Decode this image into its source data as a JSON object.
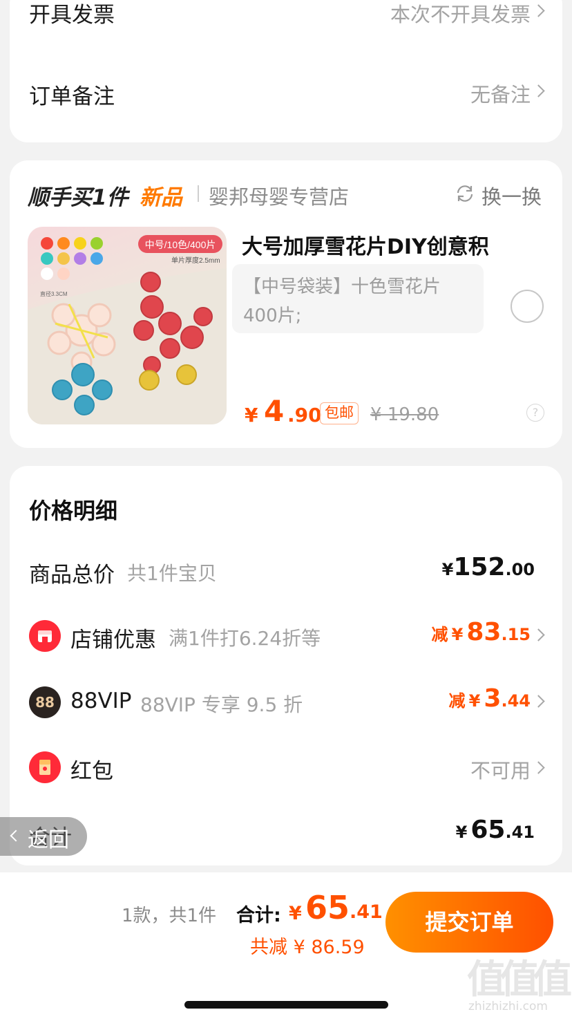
{
  "invoice": {
    "label": "开具发票",
    "value": "本次不开具发票"
  },
  "order_note": {
    "label": "订单备注",
    "value": "无备注"
  },
  "add_on": {
    "title": "顺手买1件",
    "new_tag": "新品",
    "store": "婴邦母婴专营店",
    "swap": "换一换",
    "product": {
      "title": "大号加厚雪花片DIY创意积",
      "sku": "【中号袋装】十色雪花片 400片;",
      "price_symbol": "¥",
      "price_int": "4",
      "price_dec": ".90",
      "free_shipping": "包邮",
      "original_price": "¥ 19.80",
      "image_badge": "中号/10色/400片",
      "image_note": "单片厚度2.5mm",
      "image_diameter": "直径3.3CM"
    }
  },
  "price_details": {
    "title": "价格明细",
    "goods_total": {
      "label": "商品总价",
      "sub": "共1件宝贝",
      "yen": "¥",
      "int": "152",
      "dec": ".00"
    },
    "store_discount": {
      "label": "店铺优惠",
      "sub": "满1件打6.24折等",
      "prefix": "减",
      "yen": "¥",
      "int": "83",
      "dec": ".15"
    },
    "vip": {
      "label": "88VIP",
      "sub": "88VIP 专享 9.5 折",
      "icon_text": "88",
      "prefix": "减",
      "yen": "¥",
      "int": "3",
      "dec": ".44"
    },
    "red_packet": {
      "label": "红包",
      "value": "不可用"
    },
    "total": {
      "label": "合计",
      "yen": "¥",
      "int": "65",
      "dec": ".41"
    }
  },
  "back_button": {
    "label": "返回"
  },
  "bottom_bar": {
    "count": "1款，共1件",
    "total_label": "合计:",
    "yen": "¥",
    "total_int": "65",
    "total_dec": ".41",
    "saved": "共减 ¥ 86.59",
    "submit": "提交订单"
  },
  "watermark": {
    "glyphs": "值",
    "url": "zhizhizhi.com"
  },
  "colors": {
    "accent": "#ff5000",
    "accent_start": "#ff9000",
    "new_tag": "#ff7a00"
  }
}
